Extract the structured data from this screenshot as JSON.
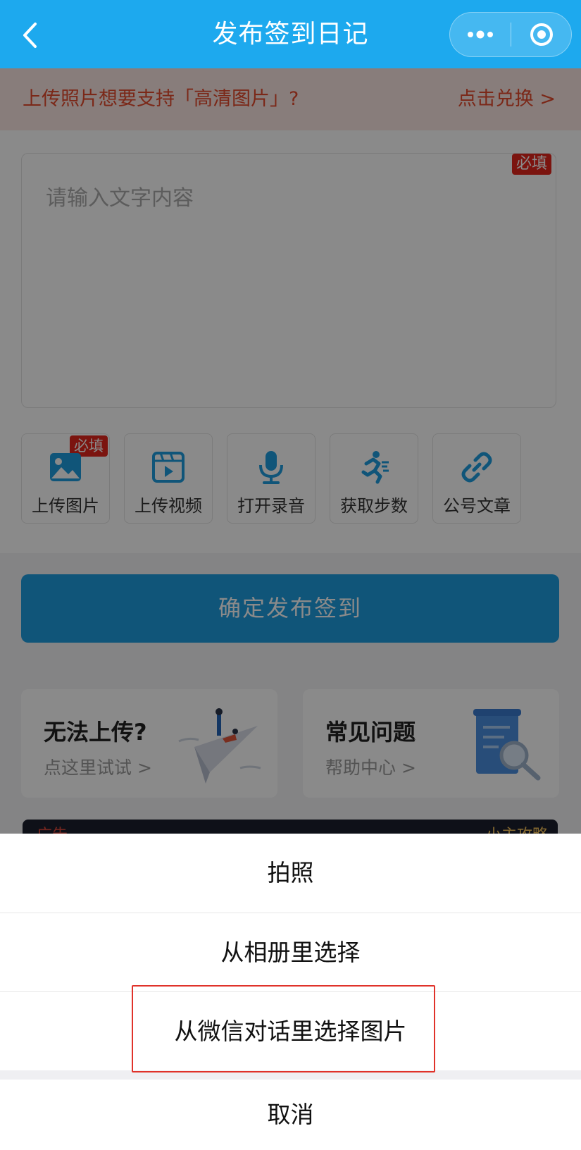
{
  "header": {
    "title": "发布签到日记",
    "more_icon": "more-dots-icon",
    "close_icon": "target-circle-icon"
  },
  "notice": {
    "text": "上传照片想要支持「高清图片」?",
    "link": "点击兑换 >"
  },
  "editor": {
    "placeholder": "请输入文字内容",
    "required_badge": "必填"
  },
  "tools": [
    {
      "label": "上传图片",
      "icon": "image-icon",
      "badge": "必填"
    },
    {
      "label": "上传视频",
      "icon": "video-icon"
    },
    {
      "label": "打开录音",
      "icon": "microphone-icon"
    },
    {
      "label": "获取步数",
      "icon": "running-icon"
    },
    {
      "label": "公号文章",
      "icon": "link-icon"
    }
  ],
  "publish_button": "确定发布签到",
  "cards": [
    {
      "title": "无法上传?",
      "subtitle": "点这里试试 >"
    },
    {
      "title": "常见问题",
      "subtitle": "帮助中心 >"
    }
  ],
  "ad": {
    "left": "广告",
    "right": "小主攻略"
  },
  "action_sheet": {
    "items": [
      "拍照",
      "从相册里选择",
      "从微信对话里选择图片"
    ],
    "cancel": "取消"
  },
  "colors": {
    "header_bg": "#1da9ee",
    "notice_text": "#e44b2e",
    "primary": "#1f9de0",
    "badge": "#e3261c",
    "highlight_border": "#e0322a"
  }
}
